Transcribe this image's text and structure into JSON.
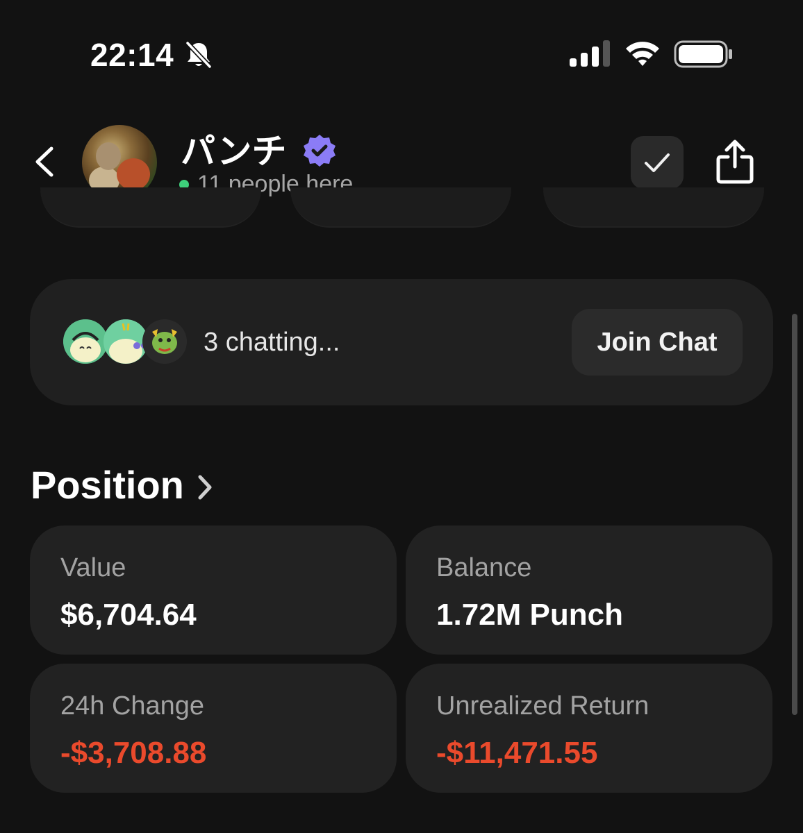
{
  "status_bar": {
    "time": "22:14",
    "icons": [
      "bell-slash-icon",
      "cellular-signal-icon",
      "wifi-icon",
      "battery-icon"
    ]
  },
  "header": {
    "title": "パンチ",
    "subtitle": "11 people here",
    "online_color": "#3ecf7b",
    "verified_color": "#8b7cf6",
    "icons": [
      "back-icon",
      "verified-icon",
      "check-icon",
      "share-icon"
    ]
  },
  "chat": {
    "status_text": "3 chatting...",
    "join_label": "Join Chat"
  },
  "position": {
    "title": "Position",
    "stats": [
      {
        "label": "Value",
        "value": "$6,704.64"
      },
      {
        "label": "Balance",
        "value": "1.72M Punch"
      },
      {
        "label": "24h Change",
        "value": "-$3,708.88"
      },
      {
        "label": "Unrealized Return",
        "value": "-$11,471.55"
      }
    ]
  },
  "colors": {
    "background": "#121212",
    "card": "#222222",
    "negative": "#ea4a2c",
    "muted_text": "#a3a3a3"
  }
}
